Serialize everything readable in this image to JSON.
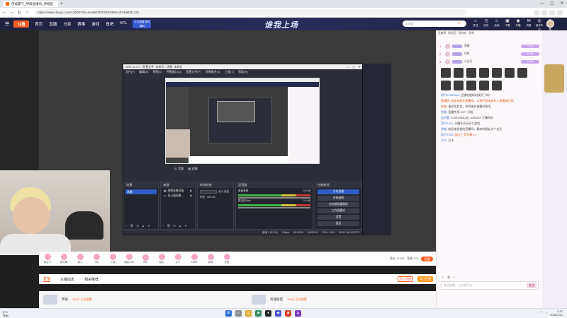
{
  "browser": {
    "tab_title": "伊威霸气_伊威直播间_伊威直播视频",
    "url": "https://www.douyu.com/12004?rid=4xv6b23f2b7b83480cu874a8bd1331",
    "new_tab": "+",
    "back": "←",
    "forward": "→",
    "reload": "↻",
    "home": "⌂"
  },
  "site": {
    "logo": "斗鱼",
    "nav": [
      "首页",
      "直播",
      "分类",
      "赛事",
      "游戏",
      "鱼吧",
      "KFL"
    ],
    "promo": "正在观看 限时福利",
    "banner_title": "谁我上场",
    "search_placeholder": "tarna",
    "header_icons": [
      {
        "glyph": "☆",
        "label": "关注"
      },
      {
        "glyph": "◷",
        "label": "历史"
      },
      {
        "glyph": "♨",
        "label": "活动"
      },
      {
        "glyph": "▣",
        "label": "下载"
      },
      {
        "glyph": "◉",
        "label": "开播"
      },
      {
        "glyph": "✉",
        "label": "消息"
      },
      {
        "glyph": "◎",
        "label": "创作中心"
      },
      {
        "glyph": "♛",
        "label": "鱼翅充值"
      }
    ]
  },
  "obs": {
    "title": "OBS 31.0.0 - 配置文件: 未命名 - 场景: 未命名",
    "menu": [
      "文件(F)",
      "编辑(E)",
      "视图(V)",
      "停靠窗口(D)",
      "配置文件(P)",
      "场景集合(S)",
      "工具(T)",
      "帮助(H)"
    ],
    "dock_bar": [
      "◎ 音量",
      "▦ 滤镜"
    ],
    "scenes_title": "场景",
    "scene_item": "场景",
    "sources_title": "来源",
    "sources": [
      "视频采集设备",
      "显示器采集"
    ],
    "filters_title": "转场特效",
    "filter_transition": "淡入淡出",
    "filter_duration_label": "时长",
    "filter_duration": "300 ms",
    "mixer_title": "混音器",
    "mixer_rows": [
      {
        "name": "桌面音频",
        "level": "0.0 dB"
      },
      {
        "name": "麦克风/Aux",
        "level": "0.0 dB"
      }
    ],
    "controls_title": "控制按钮",
    "controls": [
      "开始直播",
      "开始录制",
      "启动虚拟摄像机",
      "工作室模式",
      "设置",
      "退出"
    ],
    "status": [
      "丢帧 0 (0.0%)",
      "0 kbps",
      "00:00:00",
      "00:00:00",
      "CPU: 0.9%",
      "60.00 / 60.00 FPS"
    ]
  },
  "gifts": [
    {
      "label": "粉丝卡"
    },
    {
      "label": "荧光棒"
    },
    {
      "label": "超火"
    },
    {
      "label": "飞机"
    },
    {
      "label": "火箭"
    },
    {
      "label": "超级火箭"
    },
    {
      "label": "666"
    },
    {
      "label": "鱼丸"
    },
    {
      "label": "办卡"
    },
    {
      "label": "618年"
    },
    {
      "label": "游戏"
    },
    {
      "label": "许愿"
    }
  ],
  "giftbar": {
    "balance_label": "鱼丸 17344",
    "fish_label": "鱼翅 149",
    "charge": "充值"
  },
  "bottom_tabs": [
    "直播",
    "主播动态",
    "相关推荐"
  ],
  "bottom_buttons": {
    "outline": "投入鱼翅",
    "fill": "关注主播"
  },
  "recs": [
    {
      "title": "伊威",
      "online": "186人 正在观看"
    },
    {
      "title": "英雄联盟",
      "online": "195万 正在观看"
    }
  ],
  "chat": {
    "tabs": [
      "贡献榜",
      "粉丝团",
      "贵宾席",
      "鱼吧"
    ],
    "ranks": [
      {
        "n": "1",
        "name": "荣耀",
        "pill": "LV 62"
      },
      {
        "n": "2",
        "name": "阿鱼",
        "pill": "LV 58"
      },
      {
        "n": "3",
        "name": "小宝贝",
        "pill": "LV 51"
      }
    ],
    "messages": [
      {
        "u": "用户21532064:",
        "t": "主播吃饭的时候开了吗？"
      },
      {
        "u": "直播间:",
        "t": "欢迎来到本直播间，斗鱼严禁未成年人直播或打赏。"
      },
      {
        "u": "系统:",
        "t": "请文明发言，共同维护直播间秩序。"
      },
      {
        "u": "伊威:",
        "t": "直播专用 2077 开始"
      },
      {
        "u": "云中客:",
        "t": "10291992以后 1082034 主播你好"
      },
      {
        "u": "用户2153:",
        "t": "主播今天玩什么游戏"
      },
      {
        "u": "伊威:",
        "t": "欢迎来到我的直播间，喜欢的朋友点个关注"
      },
      {
        "u": "用户2153:",
        "t": "送出了 荧光棒 x1"
      },
      {
        "u": "大大:",
        "t": "打卡"
      }
    ],
    "input_placeholder": "发送弹幕，与主播互动",
    "send": "发送"
  },
  "taskbar": {
    "weather_temp": "8°C",
    "weather_desc": "多云",
    "time": "2:17",
    "date": "2026/1/21"
  }
}
